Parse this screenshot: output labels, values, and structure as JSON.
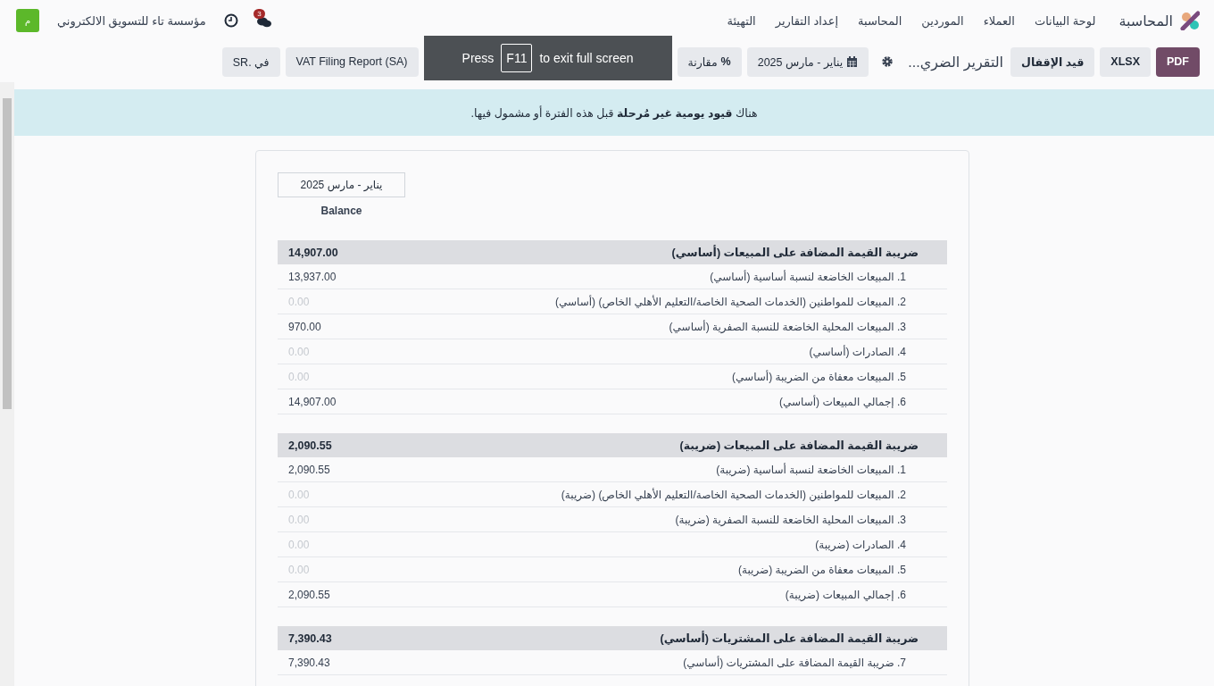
{
  "navbar": {
    "app_name": "المحاسبة",
    "menu": [
      {
        "label": "لوحة البيانات"
      },
      {
        "label": "العملاء"
      },
      {
        "label": "الموردين"
      },
      {
        "label": "المحاسبة"
      },
      {
        "label": "إعداد التقارير"
      },
      {
        "label": "التهيئة"
      }
    ],
    "messages_count": "3",
    "company": "مؤسسة تاء للتسويق الالكتروني",
    "avatar_letter": "م"
  },
  "toolbar": {
    "buttons": [
      {
        "label": "PDF",
        "kind": "primary"
      },
      {
        "label": "XLSX",
        "kind": "secondary"
      },
      {
        "label": "قيد الإقفال",
        "kind": "secondary"
      }
    ],
    "report_title": "التقرير الضري...",
    "date_filter": "يناير - مارس 2025",
    "compare_icon": "%",
    "compare_filter": "مقارنة",
    "report_filter": "VAT Filing Report (SA)",
    "currency_filter": "في .SR"
  },
  "fullscreen_notice": {
    "before": "Press",
    "key": "F11",
    "after": "to exit full screen"
  },
  "alert": "هناك **قيود يومية غير مُرحلة** قبل هذه الفترة أو مشمول فيها.",
  "report": {
    "column_period": "يناير - مارس 2025",
    "column_label": "Balance",
    "sections": [
      {
        "title": "ضريبة القيمة المضافة على المبيعات (أساسي)",
        "total": "14,907.00",
        "rows": [
          {
            "label": "1. المبيعات الخاضعة لنسبة أساسية (أساسي)",
            "value": "13,937.00",
            "muted": false
          },
          {
            "label": "2. المبيعات للمواطنين (الخدمات الصحية الخاصة/التعليم الأهلي الخاص) (أساسي)",
            "value": "0.00",
            "muted": true
          },
          {
            "label": "3. المبيعات المحلية الخاضعة للنسبة الصفرية (أساسي)",
            "value": "970.00",
            "muted": false
          },
          {
            "label": "4. الصادرات (أساسي)",
            "value": "0.00",
            "muted": true
          },
          {
            "label": "5. المبيعات معفاة من الضريبة (أساسي)",
            "value": "0.00",
            "muted": true
          },
          {
            "label": "6. إجمالي المبيعات (أساسي)",
            "value": "14,907.00",
            "muted": false
          }
        ]
      },
      {
        "title": "ضريبة القيمة المضافة على المبيعات (ضريبة)",
        "total": "2,090.55",
        "rows": [
          {
            "label": "1. المبيعات الخاضعة لنسبة أساسية (ضريبة)",
            "value": "2,090.55",
            "muted": false
          },
          {
            "label": "2. المبيعات للمواطنين (الخدمات الصحية الخاصة/التعليم الأهلي الخاص) (ضريبة)",
            "value": "0.00",
            "muted": true
          },
          {
            "label": "3. المبيعات المحلية الخاضعة للنسبة الصفرية (ضريبة)",
            "value": "0.00",
            "muted": true
          },
          {
            "label": "4. الصادرات (ضريبة)",
            "value": "0.00",
            "muted": true
          },
          {
            "label": "5. المبيعات معفاة من الضريبة (ضريبة)",
            "value": "0.00",
            "muted": true
          },
          {
            "label": "6. إجمالي المبيعات (ضريبة)",
            "value": "2,090.55",
            "muted": false
          }
        ]
      },
      {
        "title": "ضريبة القيمة المضافة على المشتريات (أساسي)",
        "total": "7,390.43",
        "rows": [
          {
            "label": "7. ضريبة القيمة المضافة على المشتريات (أساسي)",
            "value": "7,390.43",
            "muted": false
          }
        ]
      }
    ]
  }
}
